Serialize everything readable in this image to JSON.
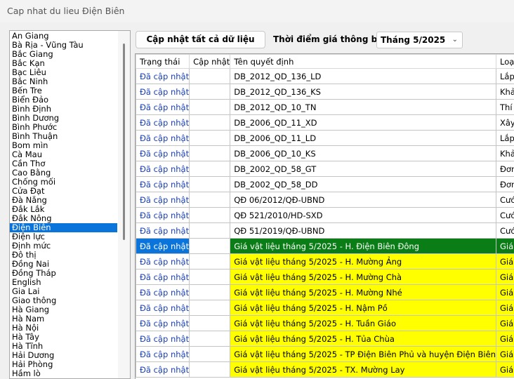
{
  "window": {
    "title": "Cap nhat du lieu Điện Biên"
  },
  "toolbar": {
    "update_all_label": "Cập nhật tất cả dữ liệu",
    "time_label": "Thời điểm giá thông báo",
    "month_value": "Tháng 5/2025"
  },
  "provinces": [
    "An Giang",
    "Bà Rịa - Vũng Tàu",
    "Bắc Giang",
    "Bắc Kạn",
    "Bạc Liêu",
    "Bắc Ninh",
    "Bến Tre",
    "Biển Đảo",
    "Bình Định",
    "Bình Dương",
    "Bình Phước",
    "Bình Thuận",
    "Bom mìn",
    "Cà Mau",
    "Cần Thơ",
    "Cao Bằng",
    "Chống mối",
    "Cửa Đạt",
    "Đà Nẵng",
    "Đắk Lắk",
    "Đắk Nông",
    "Điện Biên",
    "Điện lực",
    "Định mức",
    "Đô thị",
    "Đồng Nai",
    "Đồng Tháp",
    "English",
    "Gia Lai",
    "Giao thông",
    "Hà Giang",
    "Hà Nam",
    "Hà Nội",
    "Hà Tây",
    "Hà Tĩnh",
    "Hải Dương",
    "Hải Phòng",
    "Hầm lò"
  ],
  "selected_province": "Điện Biên",
  "table": {
    "headers": [
      "Trạng thái",
      "Cập nhật",
      "Tên quyết định",
      "Loại"
    ],
    "rows": [
      {
        "status": "Đã cập nhật",
        "update": "",
        "name": "DB_2012_QD_136_LD",
        "type": "Lắp đặt",
        "style": ""
      },
      {
        "status": "Đã cập nhật",
        "update": "",
        "name": "DB_2012_QD_136_KS",
        "type": "Khảo sát",
        "style": ""
      },
      {
        "status": "Đã cập nhật",
        "update": "",
        "name": "DB_2012_QD_10_TN",
        "type": "Thí nghiệm vật liệu",
        "style": ""
      },
      {
        "status": "Đã cập nhật",
        "update": "",
        "name": "DB_2006_QD_11_XD",
        "type": "Xây dựng",
        "style": ""
      },
      {
        "status": "Đã cập nhật",
        "update": "",
        "name": "DB_2006_QD_11_LD",
        "type": "Lắp đặt",
        "style": ""
      },
      {
        "status": "Đã cập nhật",
        "update": "",
        "name": "DB_2006_QD_10_KS",
        "type": "Khảo sát",
        "style": ""
      },
      {
        "status": "Đã cập nhật",
        "update": "",
        "name": "DB_2002_QD_58_GT",
        "type": "Đơn giá",
        "style": ""
      },
      {
        "status": "Đã cập nhật",
        "update": "",
        "name": "DB_2002_QD_58_DD",
        "type": "Đơn giá",
        "style": ""
      },
      {
        "status": "Đã cập nhật",
        "update": "",
        "name": "QĐ 06/2012/QĐ-UBND",
        "type": "Cước ô tô",
        "style": ""
      },
      {
        "status": "Đã cập nhật",
        "update": "",
        "name": "QĐ 521/2010/HD-SXD",
        "type": "Cước bộ",
        "style": ""
      },
      {
        "status": "Đã cập nhật",
        "update": "",
        "name": "QĐ 51/2019/QĐ-UBND",
        "type": "Cước ô tô",
        "style": ""
      },
      {
        "status": "Đã cập nhật",
        "update": "",
        "name": "Giá vật liệu tháng 5/2025 - H. Điện Biên Đông",
        "type": "Giá thông báo",
        "style": "sel"
      },
      {
        "status": "Đã cập nhật",
        "update": "",
        "name": "Giá vật liệu tháng 5/2025 - H. Mường Ảng",
        "type": "Giá thông báo",
        "style": "yellow"
      },
      {
        "status": "Đã cập nhật",
        "update": "",
        "name": "Giá vật liệu tháng 5/2025 - H. Mường Chà",
        "type": "Giá thông báo",
        "style": "yellow"
      },
      {
        "status": "Đã cập nhật",
        "update": "",
        "name": "Giá vật liệu tháng 5/2025 - H. Mường Nhé",
        "type": "Giá thông báo",
        "style": "yellow"
      },
      {
        "status": "Đã cập nhật",
        "update": "",
        "name": "Giá vật liệu tháng 5/2025 - H. Nậm Pồ",
        "type": "Giá thông báo",
        "style": "yellow"
      },
      {
        "status": "Đã cập nhật",
        "update": "",
        "name": "Giá vật liệu tháng 5/2025 - H. Tuần Giáo",
        "type": "Giá thông báo",
        "style": "yellow"
      },
      {
        "status": "Đã cập nhật",
        "update": "",
        "name": "Giá vật liệu tháng 5/2025 - H. Tủa Chùa",
        "type": "Giá thông báo",
        "style": "yellow"
      },
      {
        "status": "Đã cập nhật",
        "update": "",
        "name": "Giá vật liệu tháng 5/2025 - TP Điện Biên Phủ và huyện Điện Biên",
        "type": "Giá thông báo",
        "style": "yellow"
      },
      {
        "status": "Đã cập nhật",
        "update": "",
        "name": "Giá vật liệu tháng 5/2025 - TX. Mường Lay",
        "type": "Giá thông báo",
        "style": "yellow"
      }
    ]
  },
  "colors": {
    "selection_blue": "#0a74da",
    "highlight_green": "#0b7d16",
    "highlight_yellow": "#ffff00",
    "status_text": "#1a40b8"
  }
}
